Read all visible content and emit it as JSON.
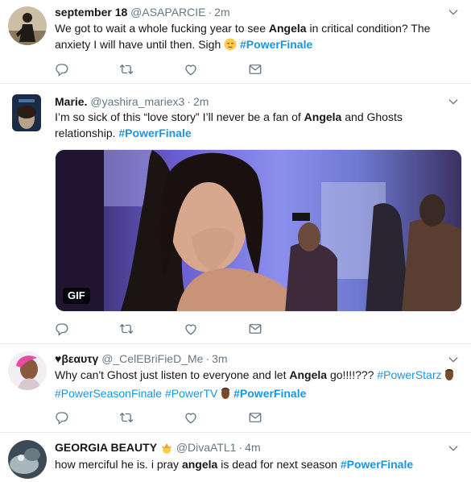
{
  "tweets": [
    {
      "name": "september 18",
      "handle": "@ASAPARCIE",
      "separator": "·",
      "time": "2m",
      "text": {
        "p1": "We got to wait a whole fucking year to see ",
        "kw": "Angela",
        "p2": " in critical condition? The anxiety I will have until then. Sigh ",
        "tag": "#PowerFinale"
      }
    },
    {
      "name": "Marie.",
      "handle": "@yashira_mariex3",
      "separator": "·",
      "time": "2m",
      "text": {
        "p1": "I’m so sick of this “love story” I’ll never be a fan of ",
        "kw": "Angela",
        "p2": " and Ghosts relationship. ",
        "tag": "#PowerFinale"
      },
      "media_badge": "GIF"
    },
    {
      "name": "♥βεαυτγ",
      "handle": "@_CelEBriFieD_Me",
      "separator": "·",
      "time": "3m",
      "text": {
        "p1": "Why can't Ghost just listen to everyone and let ",
        "kw": "Angela",
        "p2": " go!!!!??? ",
        "tag1": "#PowerStarz",
        "tag2": "#PowerSeasonFinale",
        "tag3": "#PowerTV",
        "tag4": "#PowerFinale"
      }
    },
    {
      "name": "GEORGIA BEAUTY",
      "handle": "@DivaATL1",
      "separator": "·",
      "time": "4m",
      "text": {
        "p1": "how merciful he is. i pray ",
        "kw": "angela",
        "p2": " is dead for next season ",
        "tag": "#PowerFinale"
      }
    }
  ],
  "colors": {
    "link": "#1b95e0",
    "muted": "#657786",
    "text": "#14171a",
    "border": "#e6ecf0"
  },
  "icons": [
    "reply-icon",
    "retweet-icon",
    "like-icon",
    "message-icon",
    "chevron-down-icon"
  ]
}
